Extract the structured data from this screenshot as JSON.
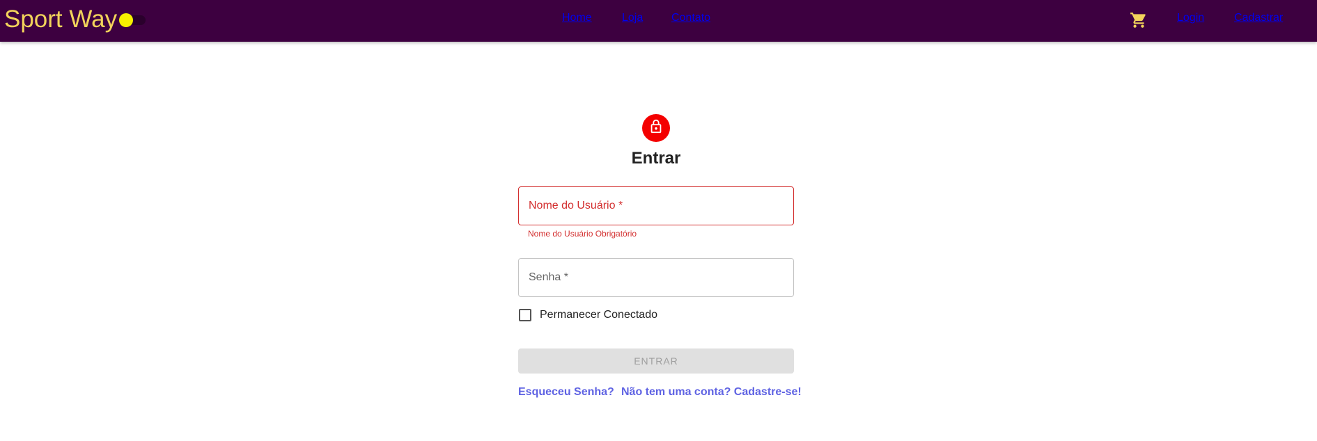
{
  "header": {
    "brand": "Sport Way",
    "nav": [
      "Home",
      "Loja",
      "Contato"
    ],
    "login": "Login",
    "register": "Cadastrar",
    "theme_toggle_on": true
  },
  "form": {
    "title": "Entrar",
    "username": {
      "placeholder": "Nome do Usuário *",
      "value": "",
      "error": "Nome do Usuário Obrigatório"
    },
    "password": {
      "placeholder": "Senha *",
      "value": ""
    },
    "remember_label": "Permanecer Conectado",
    "remember_checked": false,
    "submit_label": "ENTRAR",
    "forgot_link": "Esqueceu Senha?",
    "signup_link": "Não tem uma conta? Cadastre-se!"
  },
  "icons": {
    "cart": "shopping-cart-icon",
    "lock": "lock-icon"
  },
  "colors": {
    "appbar": "#3d0040",
    "nav_text": "#f2d35b",
    "toggle_thumb": "#f5f000",
    "lock_bg": "#f40000",
    "error": "#d32f2f",
    "link": "#5f63e3",
    "disabled_button": "#e0e0e0"
  }
}
